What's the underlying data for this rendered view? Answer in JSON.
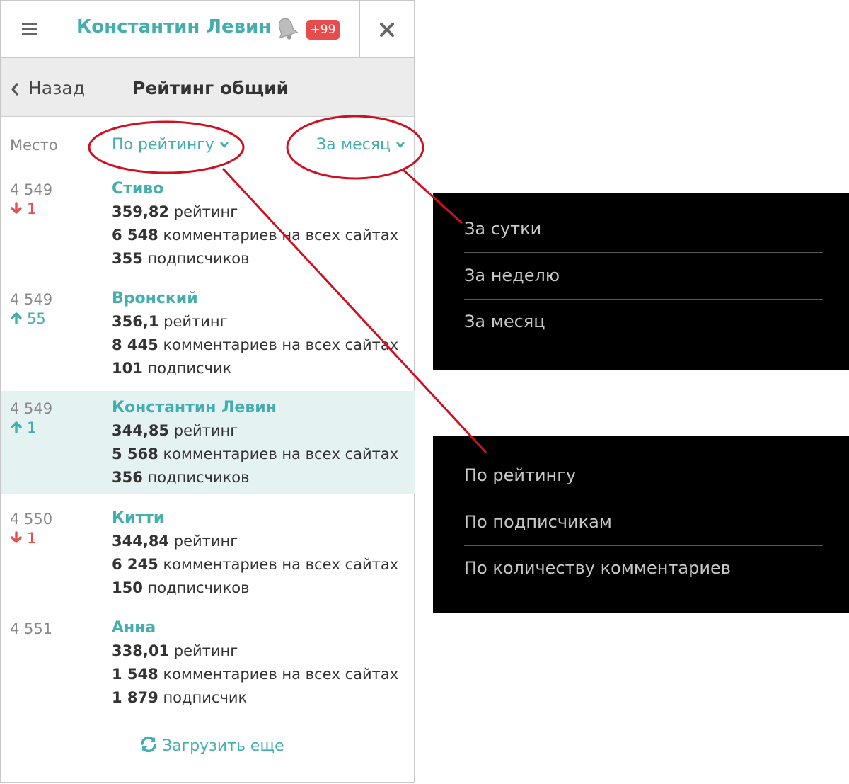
{
  "header": {
    "user_name": "Константин Левин",
    "notifications_badge": "+99"
  },
  "subheader": {
    "back_label": "Назад",
    "title": "Рейтинг общий"
  },
  "filters": {
    "place_label": "Место",
    "sort_label": "По рейтингу",
    "period_label": "За месяц"
  },
  "entries": [
    {
      "place": "4 549",
      "trend": "down",
      "delta": "1",
      "name": "Стиво",
      "rating_value": "359,82",
      "rating_unit": "рейтинг",
      "comments_value": "6 548",
      "comments_unit": "комментариев на всех сайтах",
      "subs_value": "355",
      "subs_unit": "подписчиков",
      "highlight": false
    },
    {
      "place": "4 549",
      "trend": "up",
      "delta": "55",
      "name": "Вронский",
      "rating_value": "356,1",
      "rating_unit": "рейтинг",
      "comments_value": "8 445",
      "comments_unit": "комментариев на всех сайтах",
      "subs_value": "101",
      "subs_unit": "подписчик",
      "highlight": false
    },
    {
      "place": "4 549",
      "trend": "up",
      "delta": "1",
      "name": "Константин Левин",
      "rating_value": "344,85",
      "rating_unit": "рейтинг",
      "comments_value": "5 568",
      "comments_unit": "комментариев на всех сайтах",
      "subs_value": "356",
      "subs_unit": "подписчиков",
      "highlight": true
    },
    {
      "place": "4 550",
      "trend": "down",
      "delta": "1",
      "name": "Китти",
      "rating_value": "344,84",
      "rating_unit": "рейтинг",
      "comments_value": "6 245",
      "comments_unit": "комментариев на всех сайтах",
      "subs_value": "150",
      "subs_unit": "подписчиков",
      "highlight": false
    },
    {
      "place": "4 551",
      "trend": "none",
      "delta": "",
      "name": "Анна",
      "rating_value": "338,01",
      "rating_unit": "рейтинг",
      "comments_value": "1 548",
      "comments_unit": "комментариев на всех сайтах",
      "subs_value": "1 879",
      "subs_unit": "подписчик",
      "highlight": false
    }
  ],
  "load_more_label": "Загрузить еще",
  "period_dropdown": {
    "options": [
      "За сутки",
      "За неделю",
      "За месяц"
    ]
  },
  "sort_dropdown": {
    "options": [
      "По рейтингу",
      "По подписчикам",
      "По количеству комментариев"
    ]
  },
  "colors": {
    "accent": "#44aeae",
    "badge": "#e74c4c",
    "down": "#e05050",
    "highlight_row": "#e4f2f2",
    "annotation": "#d01020",
    "popup_bg": "#000000"
  },
  "icons": [
    "menu-icon",
    "bell-icon",
    "close-icon",
    "chevron-left-icon",
    "chevron-down-icon",
    "arrow-down-icon",
    "arrow-up-icon",
    "refresh-icon"
  ]
}
